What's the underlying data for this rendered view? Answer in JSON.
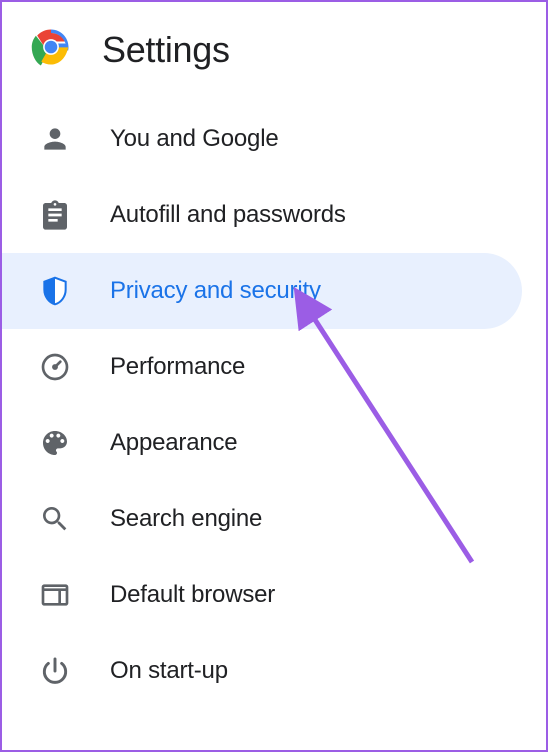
{
  "header": {
    "title": "Settings"
  },
  "nav": {
    "items": [
      {
        "id": "you-and-google",
        "label": "You and Google",
        "icon": "person-icon",
        "active": false
      },
      {
        "id": "autofill",
        "label": "Autofill and passwords",
        "icon": "clipboard-icon",
        "active": false
      },
      {
        "id": "privacy",
        "label": "Privacy and security",
        "icon": "shield-icon",
        "active": true
      },
      {
        "id": "performance",
        "label": "Performance",
        "icon": "gauge-icon",
        "active": false
      },
      {
        "id": "appearance",
        "label": "Appearance",
        "icon": "palette-icon",
        "active": false
      },
      {
        "id": "search-engine",
        "label": "Search engine",
        "icon": "search-icon",
        "active": false
      },
      {
        "id": "default-browser",
        "label": "Default browser",
        "icon": "browser-icon",
        "active": false
      },
      {
        "id": "on-startup",
        "label": "On start-up",
        "icon": "power-icon",
        "active": false
      }
    ]
  },
  "annotation": {
    "arrow_target": "privacy",
    "arrow_color": "#9b5de5"
  }
}
